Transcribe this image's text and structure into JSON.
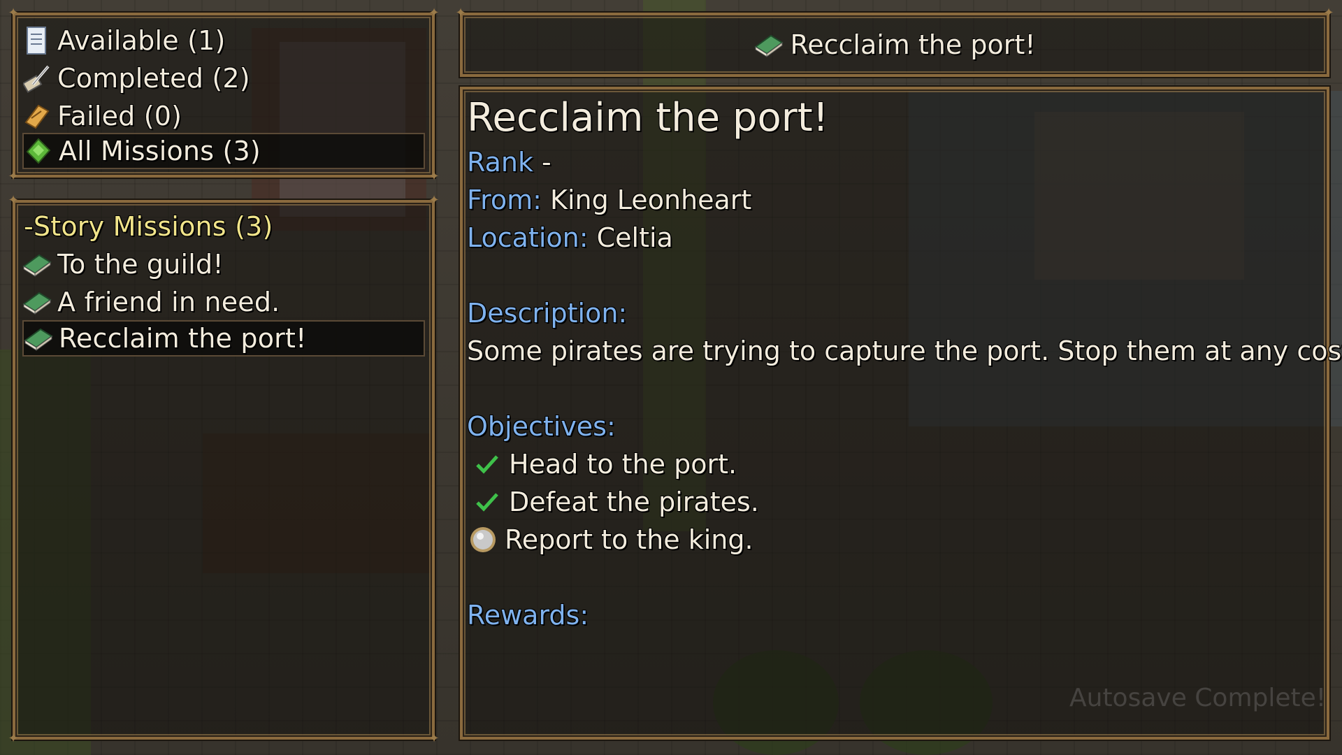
{
  "filters": [
    {
      "label": "Available (1)",
      "icon": "scroll-icon"
    },
    {
      "label": "Completed (2)",
      "icon": "quill-icon"
    },
    {
      "label": "Failed (0)",
      "icon": "torn-scroll-icon"
    },
    {
      "label": "All Missions (3)",
      "icon": "green-gem-icon",
      "selected": true
    }
  ],
  "mission_list": {
    "category": "-Story Missions (3)",
    "items": [
      {
        "label": "To the guild!",
        "icon": "green-book-icon"
      },
      {
        "label": "A friend in need.",
        "icon": "green-book-icon"
      },
      {
        "label": "Recclaim the port!",
        "icon": "green-book-icon",
        "selected": true
      }
    ]
  },
  "header": {
    "title": "Recclaim the port!",
    "icon": "green-book-icon"
  },
  "detail": {
    "title": "Recclaim the port!",
    "rank_label": "Rank",
    "rank_value": "-",
    "from_label": "From:",
    "from_value": "King Leonheart",
    "location_label": "Location:",
    "location_value": "Celtia",
    "description_label": "Description:",
    "description_text": "Some pirates are trying to capture the port. Stop them at any costs!",
    "objectives_label": "Objectives:",
    "objectives": [
      {
        "text": "Head to the port.",
        "status": "done",
        "icon": "checkmark-icon"
      },
      {
        "text": "Defeat the pirates.",
        "status": "done",
        "icon": "checkmark-icon"
      },
      {
        "text": "Report to the king.",
        "status": "pending",
        "icon": "pending-orb-icon"
      }
    ],
    "rewards_label": "Rewards:"
  },
  "autosave": "Autosave Complete!",
  "colors": {
    "frame": "#8a6a3e",
    "label_blue": "#7fb2ee",
    "category_yellow": "#f1e48a",
    "check_green": "#3fc14a"
  }
}
